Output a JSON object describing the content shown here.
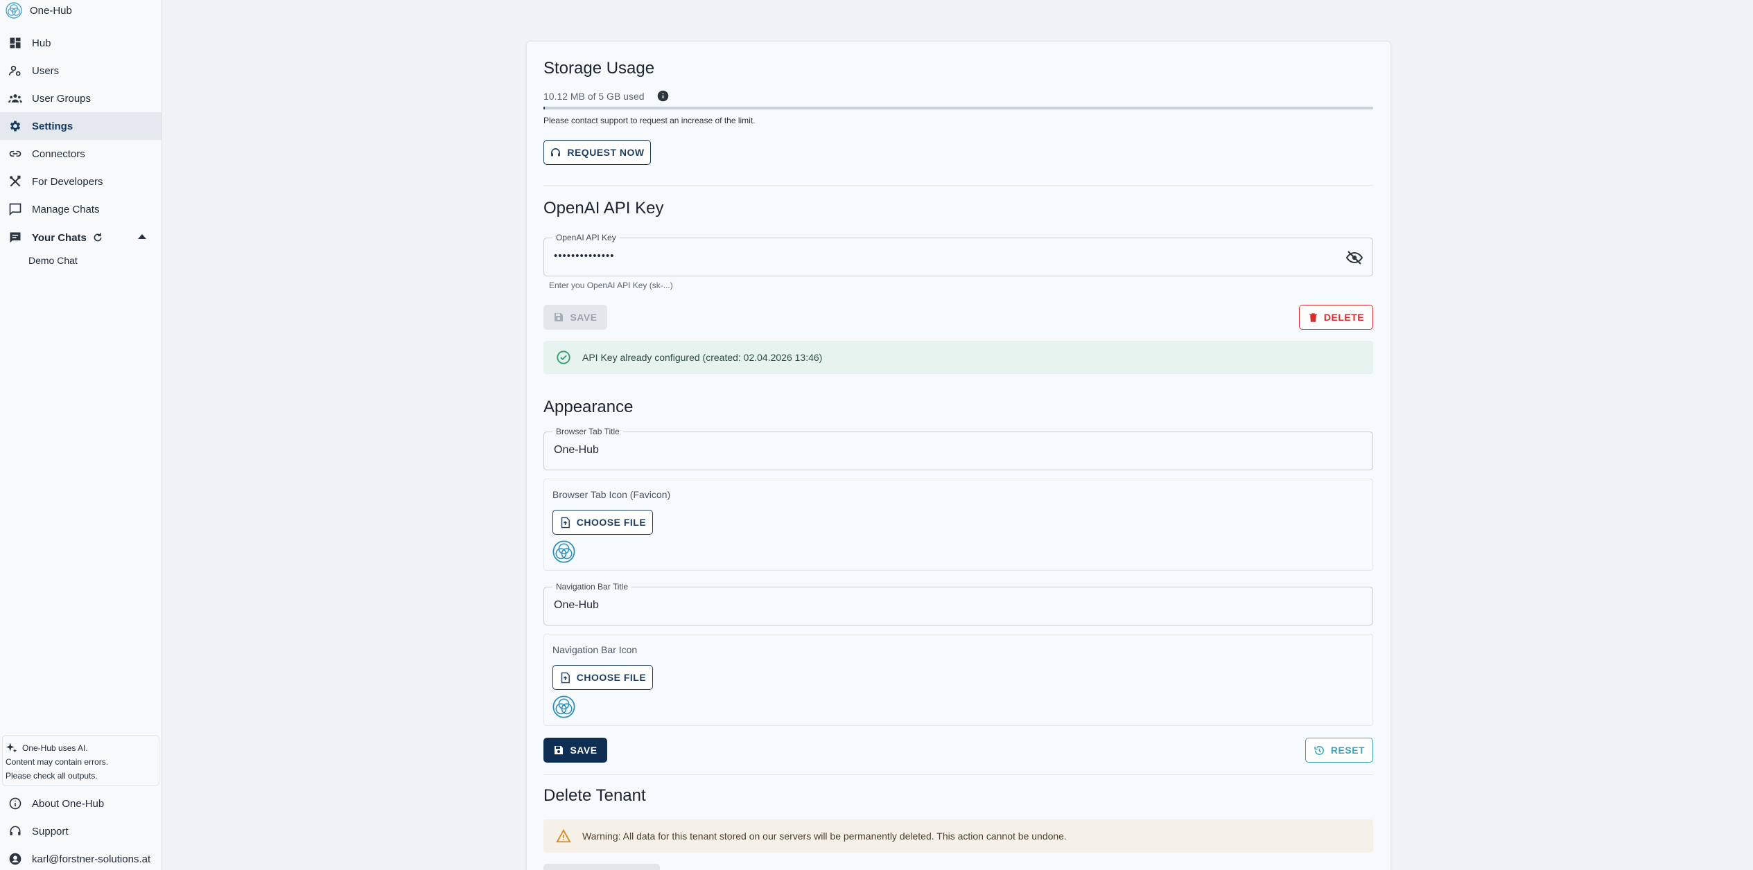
{
  "brand": {
    "name": "One-Hub",
    "icon": "one-hub-logo"
  },
  "sidebar": {
    "items": [
      {
        "label": "Hub",
        "icon": "dashboard-icon"
      },
      {
        "label": "Users",
        "icon": "user-gear-icon"
      },
      {
        "label": "User Groups",
        "icon": "groups-icon"
      },
      {
        "label": "Settings",
        "icon": "gear-icon",
        "active": true
      },
      {
        "label": "Connectors",
        "icon": "link-icon"
      },
      {
        "label": "For Developers",
        "icon": "tools-icon"
      },
      {
        "label": "Manage Chats",
        "icon": "chat-bubble-icon"
      }
    ],
    "your_chats": {
      "label": "Your Chats",
      "items": [
        "Demo Chat"
      ]
    },
    "ai_note": {
      "line1": "One-Hub uses AI.",
      "line2": "Content may contain errors.",
      "line3": "Please check all outputs."
    },
    "bottom": [
      {
        "label": "About One-Hub",
        "icon": "info-icon"
      },
      {
        "label": "Support",
        "icon": "headset-icon"
      },
      {
        "label": "karl@forstner-solutions.at",
        "icon": "account-icon"
      }
    ]
  },
  "storage": {
    "title": "Storage Usage",
    "usage_text": "10.12 MB of 5 GB used",
    "used_fraction": 0.002,
    "note": "Please contact support to request an increase of the limit.",
    "request_button": "REQUEST NOW"
  },
  "openai": {
    "title": "OpenAI API Key",
    "field_label": "OpenAI API Key",
    "field_value": "••••••••••••••",
    "helper": "Enter you OpenAI API Key (sk-...)",
    "save_button": "SAVE",
    "delete_button": "DELETE",
    "status": "API Key already configured (created: 02.04.2026 13:46)"
  },
  "appearance": {
    "title": "Appearance",
    "tab_title_label": "Browser Tab Title",
    "tab_title_value": "One-Hub",
    "favicon_label": "Browser Tab Icon (Favicon)",
    "choose_file": "CHOOSE FILE",
    "nav_title_label": "Navigation Bar Title",
    "nav_title_value": "One-Hub",
    "nav_icon_label": "Navigation Bar Icon",
    "save_button": "SAVE",
    "reset_button": "RESET"
  },
  "delete_tenant": {
    "title": "Delete Tenant",
    "warning": "Warning: All data for this tenant stored on our servers will be permanently deleted. This action cannot be undone."
  },
  "colors": {
    "primary": "#0f2f52",
    "success_bg": "#e6f3ee",
    "success_icon": "#2e9e6b",
    "danger": "#d32f2f",
    "reset": "#3aa6b9",
    "warning_bg": "#f6f1e8",
    "warning_icon": "#d98b1c"
  }
}
